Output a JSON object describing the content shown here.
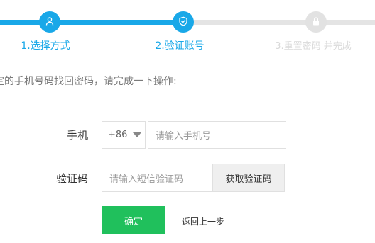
{
  "steps": [
    {
      "label": "1.选择方式",
      "icon": "user-icon",
      "state": "done"
    },
    {
      "label": "2.验证账号",
      "icon": "shield-check-icon",
      "state": "current"
    },
    {
      "label": "3.重置密码 并完成",
      "icon": "lock-icon",
      "state": "pending"
    }
  ],
  "instruction": "定的手机号码找回密码，请完成一下操作:",
  "form": {
    "phone_label": "手机",
    "country_code": "+86",
    "phone_placeholder": "请输入手机号",
    "code_label": "验证码",
    "code_placeholder": "请输入短信验证码",
    "get_code_button": "获取验证码"
  },
  "actions": {
    "confirm": "确定",
    "back": "返回上一步"
  },
  "colors": {
    "accent": "#19a8e8",
    "inactive": "#e2e2e2",
    "confirm": "#20c05c"
  }
}
